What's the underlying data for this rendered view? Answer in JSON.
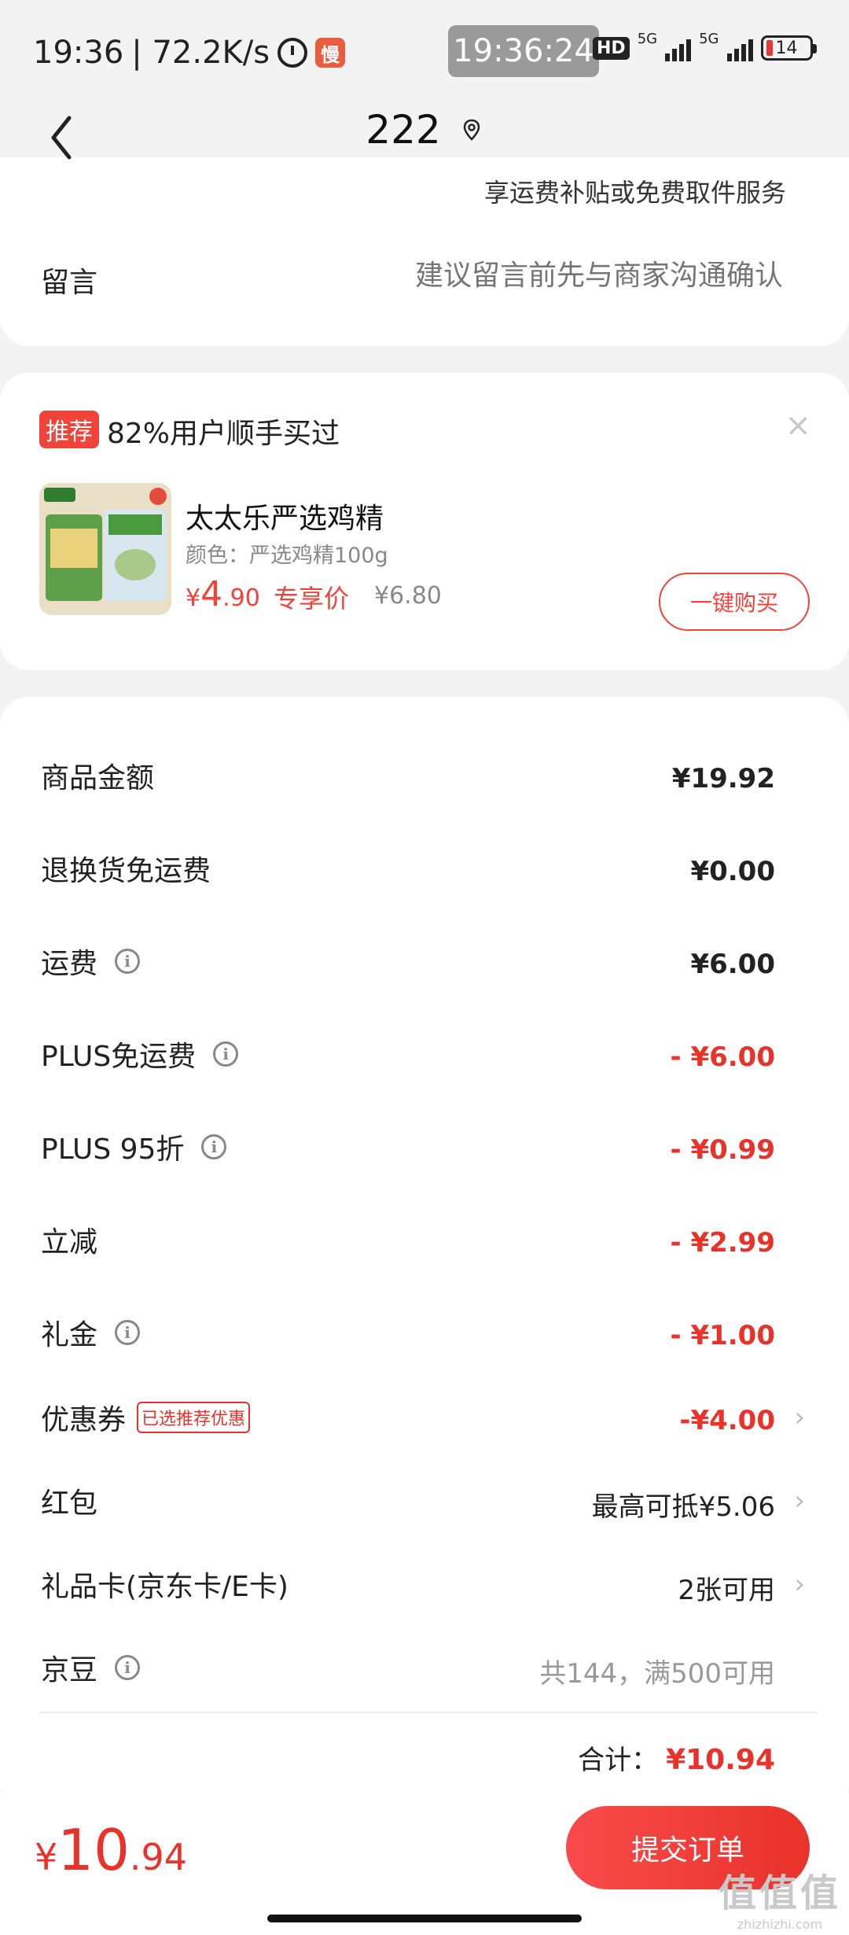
{
  "status_bar": {
    "time": "19:36",
    "speed": "| 72.2K/s",
    "app_badge": "慢",
    "center_time": "19:36:24",
    "hd": "HD",
    "net1": "5G",
    "net2": "5G",
    "battery": "14"
  },
  "header": {
    "title": "222"
  },
  "card1": {
    "partial_text": "享运费补贴或免费取件服务",
    "note_label": "留言",
    "note_placeholder": "建议留言前先与商家沟通确认"
  },
  "recommend": {
    "tag": "推荐",
    "text": "82%用户顺手买过",
    "close": "×",
    "product_name": "太太乐严选鸡精",
    "product_spec": "颜色：严选鸡精100g",
    "price_currency": "¥",
    "price_int": "4",
    "price_dec": ".90",
    "exclusive": "专享价",
    "orig_price": "¥6.80",
    "buy_button": "一键购买"
  },
  "summary": {
    "rows": [
      {
        "label": "商品金额",
        "value": "¥19.92"
      },
      {
        "label": "退换货免运费",
        "value": "¥0.00"
      },
      {
        "label": "运费",
        "value": "¥6.00"
      },
      {
        "label": "PLUS免运费",
        "value": "- ¥6.00"
      },
      {
        "label": "PLUS 95折",
        "value": "- ¥0.99"
      },
      {
        "label": "立减",
        "value": "- ¥2.99"
      },
      {
        "label": "礼金",
        "value": "- ¥1.00"
      },
      {
        "label": "优惠券",
        "tag": "已选推荐优惠",
        "value": "-¥4.00"
      },
      {
        "label": "红包",
        "value": "最高可抵¥5.06"
      },
      {
        "label": "礼品卡(京东卡/E卡)",
        "value": "2张可用"
      },
      {
        "label": "京豆",
        "value": "共144，满500可用"
      }
    ],
    "total_label": "合计：",
    "total_value": "¥10.94",
    "info_glyph": "i",
    "chevron": "›"
  },
  "bottom": {
    "price_currency": "¥",
    "price_int": "10",
    "price_dec": ".94",
    "submit": "提交订单"
  },
  "watermark": {
    "line1": "值值值",
    "line2": "zhizhizhi.com"
  },
  "colors": {
    "accent": "#e8322a",
    "background": "#f3f3f3"
  }
}
